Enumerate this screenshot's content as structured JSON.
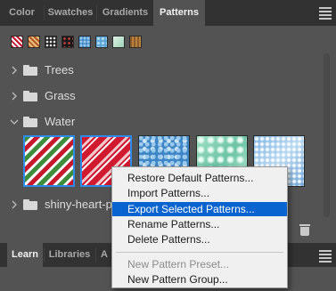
{
  "top_tabs": [
    "Color",
    "Swatches",
    "Gradients",
    "Patterns"
  ],
  "active_top_tab": "Patterns",
  "recent_swatches": [
    {
      "name": "candy-stripe-pattern",
      "colors": [
        "#c0142a",
        "#ffffff"
      ]
    },
    {
      "name": "gold-stripe-pattern",
      "colors": [
        "#b5572b",
        "#e6c07a"
      ]
    },
    {
      "name": "dots-pattern",
      "colors": [
        "#202020",
        "#e8e8e8"
      ]
    },
    {
      "name": "sprinkles-pattern",
      "colors": [
        "#1a1a1a",
        "#d94040"
      ]
    },
    {
      "name": "blue-water-pattern",
      "colors": [
        "#3f86c6",
        "#9ccaec"
      ]
    },
    {
      "name": "light-blue-pattern",
      "colors": [
        "#5aa6d8",
        "#bfe0f4"
      ]
    },
    {
      "name": "mint-pattern",
      "colors": [
        "#9fd3b8",
        "#dff2e6"
      ]
    },
    {
      "name": "wood-pattern",
      "colors": [
        "#8a5a2a",
        "#b8823f"
      ]
    }
  ],
  "groups": [
    {
      "label": "Trees",
      "expanded": false
    },
    {
      "label": "Grass",
      "expanded": false
    },
    {
      "label": "Water",
      "expanded": true
    },
    {
      "label": "shiny-heart-p",
      "expanded": false
    }
  ],
  "water_thumbnails": [
    {
      "name": "green-red-stripe-pattern",
      "selected": true
    },
    {
      "name": "red-white-stripe-pattern",
      "selected": true
    },
    {
      "name": "blue-water-pattern",
      "selected": false
    },
    {
      "name": "teal-water-pattern",
      "selected": false
    },
    {
      "name": "light-water-pattern",
      "selected": false
    }
  ],
  "bottom_tabs": [
    "Learn",
    "Libraries",
    "A"
  ],
  "active_bottom_tab": "Learn",
  "context_menu": {
    "items": [
      {
        "label": "Restore Default Patterns...",
        "state": "normal"
      },
      {
        "label": "Import Patterns...",
        "state": "normal"
      },
      {
        "label": "Export Selected Patterns...",
        "state": "highlighted"
      },
      {
        "label": "Rename Patterns...",
        "state": "normal"
      },
      {
        "label": "Delete Patterns...",
        "state": "normal"
      },
      {
        "label": "New Pattern Preset...",
        "state": "disabled"
      },
      {
        "label": "New Pattern Group...",
        "state": "normal"
      }
    ]
  },
  "colors": {
    "accent": "#0a64cf",
    "selection_border": "#2d8ceb",
    "panel_bg": "#535353",
    "tab_bar_bg": "#323232"
  }
}
